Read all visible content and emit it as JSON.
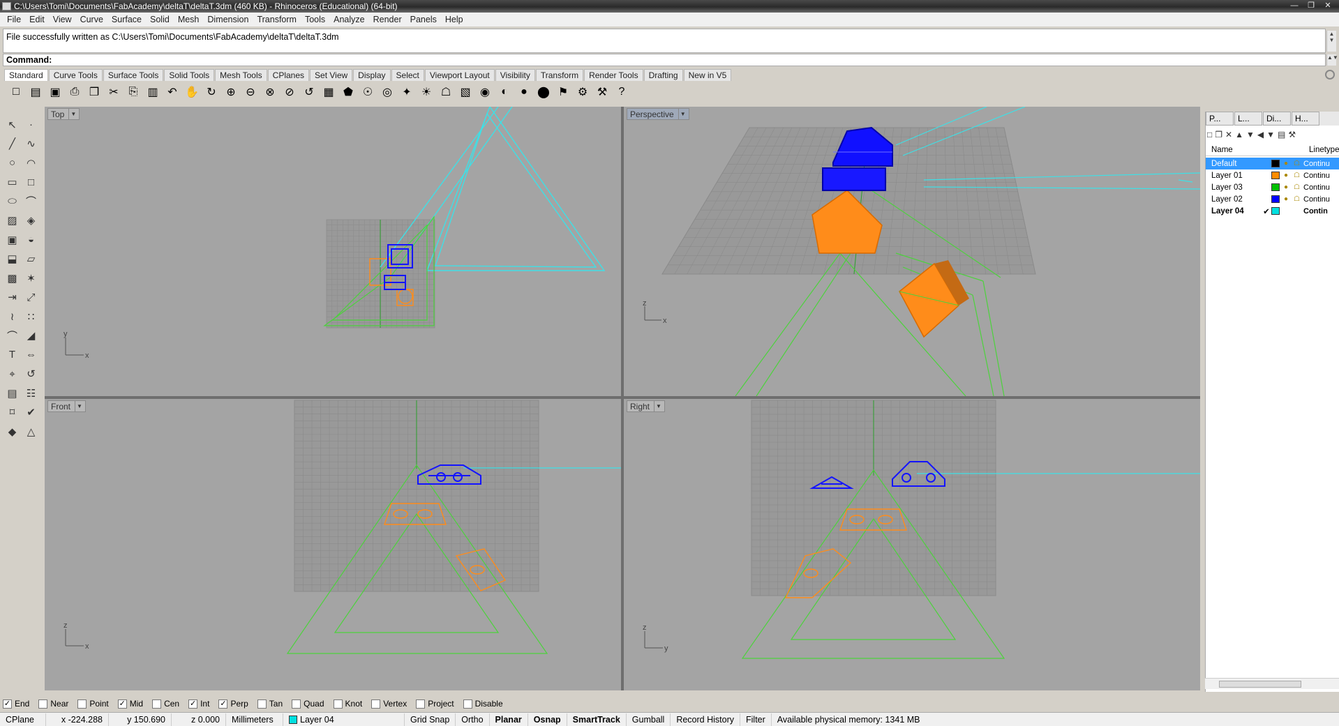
{
  "window": {
    "title": "C:\\Users\\Tomi\\Documents\\FabAcademy\\deltaT\\deltaT.3dm (460 KB) - Rhinoceros (Educational) (64-bit)"
  },
  "menu": [
    "File",
    "Edit",
    "View",
    "Curve",
    "Surface",
    "Solid",
    "Mesh",
    "Dimension",
    "Transform",
    "Tools",
    "Analyze",
    "Render",
    "Panels",
    "Help"
  ],
  "command": {
    "history": "File successfully written as C:\\Users\\Tomi\\Documents\\FabAcademy\\deltaT\\deltaT.3dm",
    "prompt": "Command:"
  },
  "toolbar_tabs": [
    "Standard",
    "Curve Tools",
    "Surface Tools",
    "Solid Tools",
    "Mesh Tools",
    "CPlanes",
    "Set View",
    "Display",
    "Select",
    "Viewport Layout",
    "Visibility",
    "Transform",
    "Render Tools",
    "Drafting",
    "New in V5"
  ],
  "toolbar_icons": [
    "new-icon",
    "open-icon",
    "save-icon",
    "print-icon",
    "import-icon",
    "cut-icon",
    "copy-icon",
    "paste-icon",
    "undo-icon",
    "pan-icon",
    "rotate-view-icon",
    "zoom-icon",
    "zoom-window-icon",
    "zoom-extents-icon",
    "zoom-selected-icon",
    "undo-view-icon",
    "four-views-icon",
    "car-icon",
    "cplane-icon",
    "object-snap-icon",
    "select-filter-icon",
    "light-icon",
    "lock-icon",
    "layer-icon",
    "color-wheel-icon",
    "material-icon",
    "shaded-sphere-icon",
    "render-sphere-icon",
    "flag-icon",
    "gears-icon",
    "options-icon",
    "help-icon"
  ],
  "left_tools": [
    "select-arrow-icon",
    "point-icon",
    "polyline-icon",
    "curve-icon",
    "circle-icon",
    "arc-icon",
    "rectangle-icon",
    "square-icon",
    "ellipse-icon",
    "fillet-curve-icon",
    "surface-icon",
    "loft-icon",
    "box-icon",
    "boolean-icon",
    "extrude-icon",
    "surface-extrude-icon",
    "mesh-icon",
    "explode-icon",
    "transform-move-icon",
    "scale-icon",
    "chain-icon",
    "array-icon",
    "curve-from-object-icon",
    "fillet-edge-icon",
    "text-icon",
    "dimension-icon",
    "analyze-icon",
    "history-icon",
    "extract-icon",
    "grid-array-icon",
    "curve-analysis-icon",
    "check-icon",
    "shade-icon",
    "render-icon"
  ],
  "viewports": {
    "top": {
      "label": "Top",
      "axis_h": "x",
      "axis_v": "y"
    },
    "perspective": {
      "label": "Perspective",
      "axis_h": "x",
      "axis_v": "z"
    },
    "front": {
      "label": "Front",
      "axis_h": "x",
      "axis_v": "z"
    },
    "right": {
      "label": "Right",
      "axis_h": "y",
      "axis_v": "z"
    }
  },
  "panel": {
    "tabs": [
      "P...",
      "L...",
      "Di...",
      "H..."
    ],
    "columns": {
      "name": "Name",
      "linetype": "Linetype"
    },
    "layers": [
      {
        "name": "Default",
        "color": "#000000",
        "linetype": "Continu",
        "selected": true,
        "current": false
      },
      {
        "name": "Layer 01",
        "color": "#ff8c00",
        "linetype": "Continu",
        "selected": false,
        "current": false
      },
      {
        "name": "Layer 03",
        "color": "#00c000",
        "linetype": "Continu",
        "selected": false,
        "current": false
      },
      {
        "name": "Layer 02",
        "color": "#0000ff",
        "linetype": "Continu",
        "selected": false,
        "current": false
      },
      {
        "name": "Layer 04",
        "color": "#00e0e0",
        "linetype": "Contin",
        "selected": false,
        "current": true,
        "check": "✔"
      }
    ]
  },
  "osnaps": [
    {
      "label": "End",
      "checked": true
    },
    {
      "label": "Near",
      "checked": false
    },
    {
      "label": "Point",
      "checked": false
    },
    {
      "label": "Mid",
      "checked": true
    },
    {
      "label": "Cen",
      "checked": false
    },
    {
      "label": "Int",
      "checked": true
    },
    {
      "label": "Perp",
      "checked": true
    },
    {
      "label": "Tan",
      "checked": false
    },
    {
      "label": "Quad",
      "checked": false
    },
    {
      "label": "Knot",
      "checked": false
    },
    {
      "label": "Vertex",
      "checked": false
    },
    {
      "label": "Project",
      "checked": false
    },
    {
      "label": "Disable",
      "checked": false
    }
  ],
  "status": {
    "cplane": "CPlane",
    "x": "x -224.288",
    "y": "y 150.690",
    "z": "z 0.000",
    "units": "Millimeters",
    "layer": "Layer 04",
    "grid_snap": "Grid Snap",
    "ortho": "Ortho",
    "planar": "Planar",
    "osnap": "Osnap",
    "smarttrack": "SmartTrack",
    "gumball": "Gumball",
    "record_history": "Record History",
    "filter": "Filter",
    "memory": "Available physical memory: 1341 MB"
  },
  "colors": {
    "viewport_bg": "#a4a4a4",
    "grid": "#8c8c8c",
    "cyan": "#3ee0e6",
    "green": "#4cd23c",
    "orange": "#ff8c1a",
    "blue": "#1414ff",
    "selected_layer": "#3399ff"
  }
}
